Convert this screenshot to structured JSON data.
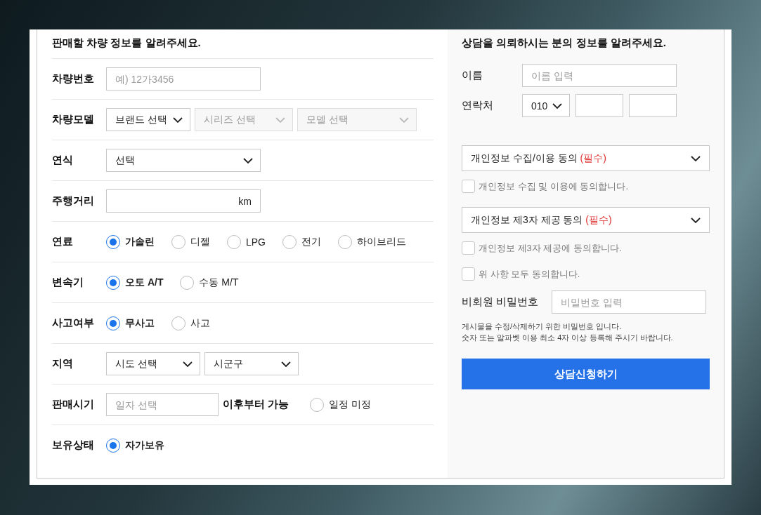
{
  "vehicle": {
    "title": "판매할 차량 정보를 알려주세요.",
    "rows": [
      {
        "label": "차량번호",
        "kind": "input",
        "placeholder": "예) 12가3456"
      },
      {
        "label": "차량모델",
        "kind": "selects",
        "selects": [
          {
            "text": "브랜드 선택",
            "disabled": false
          },
          {
            "text": "시리즈 선택",
            "disabled": true
          },
          {
            "text": "모델 선택",
            "disabled": true
          }
        ]
      },
      {
        "label": "연식",
        "kind": "selects",
        "selects": [
          {
            "text": "선택",
            "disabled": false
          }
        ]
      },
      {
        "label": "주행거리",
        "kind": "unit_input",
        "unit": "km"
      },
      {
        "label": "연료",
        "kind": "radios",
        "options": [
          {
            "label": "가솔린",
            "selected": true
          },
          {
            "label": "디젤",
            "selected": false
          },
          {
            "label": "LPG",
            "selected": false
          },
          {
            "label": "전기",
            "selected": false
          },
          {
            "label": "하이브리드",
            "selected": false
          }
        ]
      },
      {
        "label": "변속기",
        "kind": "radios",
        "options": [
          {
            "label": "오토 A/T",
            "selected": true
          },
          {
            "label": "수동 M/T",
            "selected": false
          }
        ]
      },
      {
        "label": "사고여부",
        "kind": "radios",
        "options": [
          {
            "label": "무사고",
            "selected": true
          },
          {
            "label": "사고",
            "selected": false
          }
        ]
      },
      {
        "label": "지역",
        "kind": "selects",
        "selects": [
          {
            "text": "시도 선택",
            "disabled": false
          },
          {
            "text": "시군구",
            "disabled": false
          }
        ]
      },
      {
        "label": "판매시기",
        "kind": "date",
        "placeholder": "일자 선택",
        "suffix": "이후부터 가능",
        "options": [
          {
            "label": "일정 미정",
            "selected": false
          }
        ]
      },
      {
        "label": "보유상태",
        "kind": "radios",
        "options": [
          {
            "label": "자가보유",
            "selected": true
          }
        ]
      }
    ]
  },
  "applicant": {
    "title": "상담을 의뢰하시는 분의 정보를 알려주세요.",
    "name": {
      "label": "이름",
      "placeholder": "이름 입력"
    },
    "phone": {
      "label": "연락처",
      "prefix": "010"
    },
    "consents": [
      {
        "title": "개인정보 수집/이용 동의",
        "required": "(필수)",
        "checkbox": {
          "label": "개인정보 수집 및 이용에 동의합니다.",
          "checked": false
        }
      },
      {
        "title": "개인정보 제3자 제공 동의",
        "required": "(필수)",
        "checkbox": {
          "label": "개인정보 제3자 제공에 동의합니다.",
          "checked": false
        }
      }
    ],
    "agree_all": {
      "label": "위 사항 모두 동의합니다.",
      "checked": false
    },
    "password": {
      "label": "비회원 비밀번호",
      "placeholder": "비밀번호 입력"
    },
    "notes": [
      "게시물을 수정/삭제하기 위한 비밀번호 입니다.",
      "숫자 또는 알파벳 이용 최소 4자 이상 등록해 주시기 바랍니다."
    ],
    "submit": "상담신청하기"
  }
}
